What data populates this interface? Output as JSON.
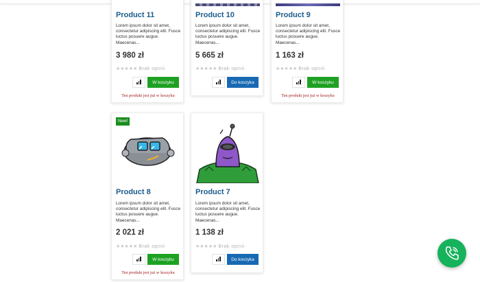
{
  "currency": "zł",
  "colors": {
    "title": "#1b5b8a",
    "cart_green": "#1ea123",
    "cart_blue": "#1769b3",
    "in_cart_text": "#a1161c",
    "new_badge": "#1a8d1f",
    "call_button": "#16b25c"
  },
  "products": [
    {
      "name": "Product 11",
      "description": "Lorem ipsum dolor sit amet, consectetur adipiscing elit. Fusce luctus posuere augue. Maecenas...",
      "price": "3 980 zł",
      "rating_label": "Brak opinii",
      "rating": 0,
      "cart_label": "W koszyku",
      "in_cart_note": "Ten produkt jest już w koszyku",
      "image": "product-image"
    },
    {
      "name": "Product 10",
      "description": "Lorem ipsum dolor sit amet, consectetur adipiscing elit. Fusce luctus posuere augue. Maecenas...",
      "price": "5 665 zł",
      "rating_label": "Brak opinii",
      "rating": 0,
      "cart_label": "Do koszyka",
      "image": "product-image"
    },
    {
      "name": "Product 9",
      "description": "Lorem ipsum dolor sit amet, consectetur adipiscing elit. Fusce luctus posuere augue. Maecenas...",
      "price": "1 163 zł",
      "rating_label": "Brak opinii",
      "rating": 0,
      "cart_label": "W koszyku",
      "in_cart_note": "Ten produkt jest już w koszyku",
      "image": "product-image"
    },
    {
      "name": "Product 8",
      "badge": "New!",
      "description": "Lorem ipsum dolor sit amet, consectetur adipiscing elit. Fusce luctus posuere augue. Maecenas...",
      "price": "2 021 zł",
      "rating_label": "Brak opinii",
      "rating": 0,
      "cart_label": "W koszyku",
      "in_cart_note": "Ten produkt jest już w koszyku",
      "image": "robot-head-image"
    },
    {
      "name": "Product 7",
      "description": "Lorem ipsum dolor sit amet, consectetur adipiscing elit. Fusce luctus posuere augue. Maecenas...",
      "price": "1 138 zł",
      "rating_label": "Brak opinii",
      "rating": 0,
      "cart_label": "Do koszyka",
      "image": "alien-robot-image"
    }
  ],
  "icons": {
    "compare": "bar-chart-icon",
    "star": "star-icon",
    "call": "phone-icon"
  }
}
